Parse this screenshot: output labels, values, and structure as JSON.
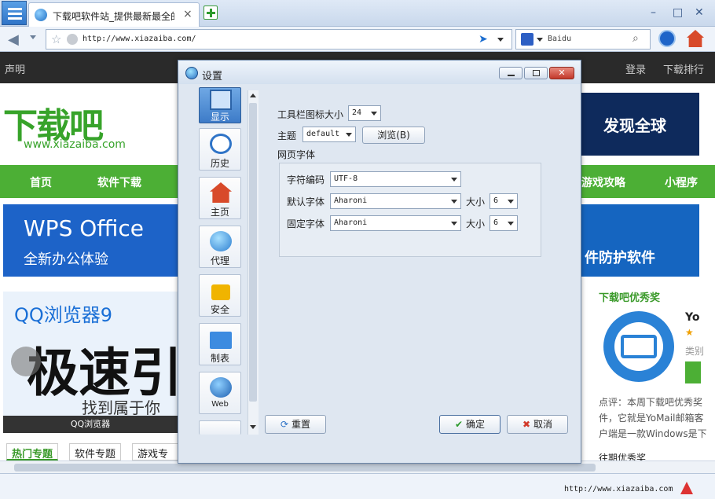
{
  "browser": {
    "tab_title": "下载吧软件站_提供最新最全的…",
    "tab_close": "×",
    "address": "http://www.xiazaiba.com/",
    "search_placeholder": "Baidu",
    "status_url": "http://www.xiazaiba.com",
    "win_min": "–",
    "win_max": "□",
    "win_close": "✕"
  },
  "page": {
    "statement": "声明",
    "login": "登录",
    "rank": "下载排行",
    "logo_text": "下载吧",
    "logo_url": "www.xiazaiba.com",
    "nav": [
      "首页",
      "软件下载",
      "游戏攻略",
      "小程序"
    ],
    "wps_title": "WPS Office",
    "wps_sub": "全新办公体验",
    "qq_title": "QQ浏览器9",
    "qq_big": "极速引",
    "qq_sub": "找到属于你",
    "qq_brand": "QQ浏览器",
    "banner_right": "发现全球",
    "banner_right2": "件防护软件",
    "award": "下载吧优秀奖",
    "yo": "Yo",
    "yo_cat": "类别",
    "desc": "点评：本周下载吧优秀奖件，它就是YoMail邮箱客户端是一款Windows是下",
    "more": "往期优秀奖",
    "tabs": [
      "热门专题",
      "软件专题",
      "游戏专题"
    ]
  },
  "dialog": {
    "title": "设置",
    "sidebar": [
      {
        "label": "显示",
        "icon": "monitor-icon"
      },
      {
        "label": "历史",
        "icon": "clock-icon"
      },
      {
        "label": "主页",
        "icon": "house-icon"
      },
      {
        "label": "代理",
        "icon": "network-globe-icon"
      },
      {
        "label": "安全",
        "icon": "lock-icon"
      },
      {
        "label": "制表",
        "icon": "folder-icon"
      },
      {
        "label": "Web",
        "icon": "globe-icon"
      }
    ],
    "toolbar_icon_size_label": "工具栏图标大小",
    "toolbar_icon_size_value": "24",
    "theme_label": "主题",
    "theme_value": "default",
    "browse_button": "浏览(B)",
    "web_font_label": "网页字体",
    "encoding_label": "字符编码",
    "encoding_value": "UTF-8",
    "default_font_label": "默认字体",
    "default_font_value": "Aharoni",
    "default_size_label": "大小",
    "default_size_value": "6",
    "fixed_font_label": "固定字体",
    "fixed_font_value": "Aharoni",
    "fixed_size_label": "大小",
    "fixed_size_value": "6",
    "reset_button": "重置",
    "ok_button": "确定",
    "cancel_button": "取消"
  },
  "colors": {
    "accent_green": "#4caf35",
    "dialog_bg": "#dfe7f1",
    "selected_blue": "#3d7bc8"
  }
}
